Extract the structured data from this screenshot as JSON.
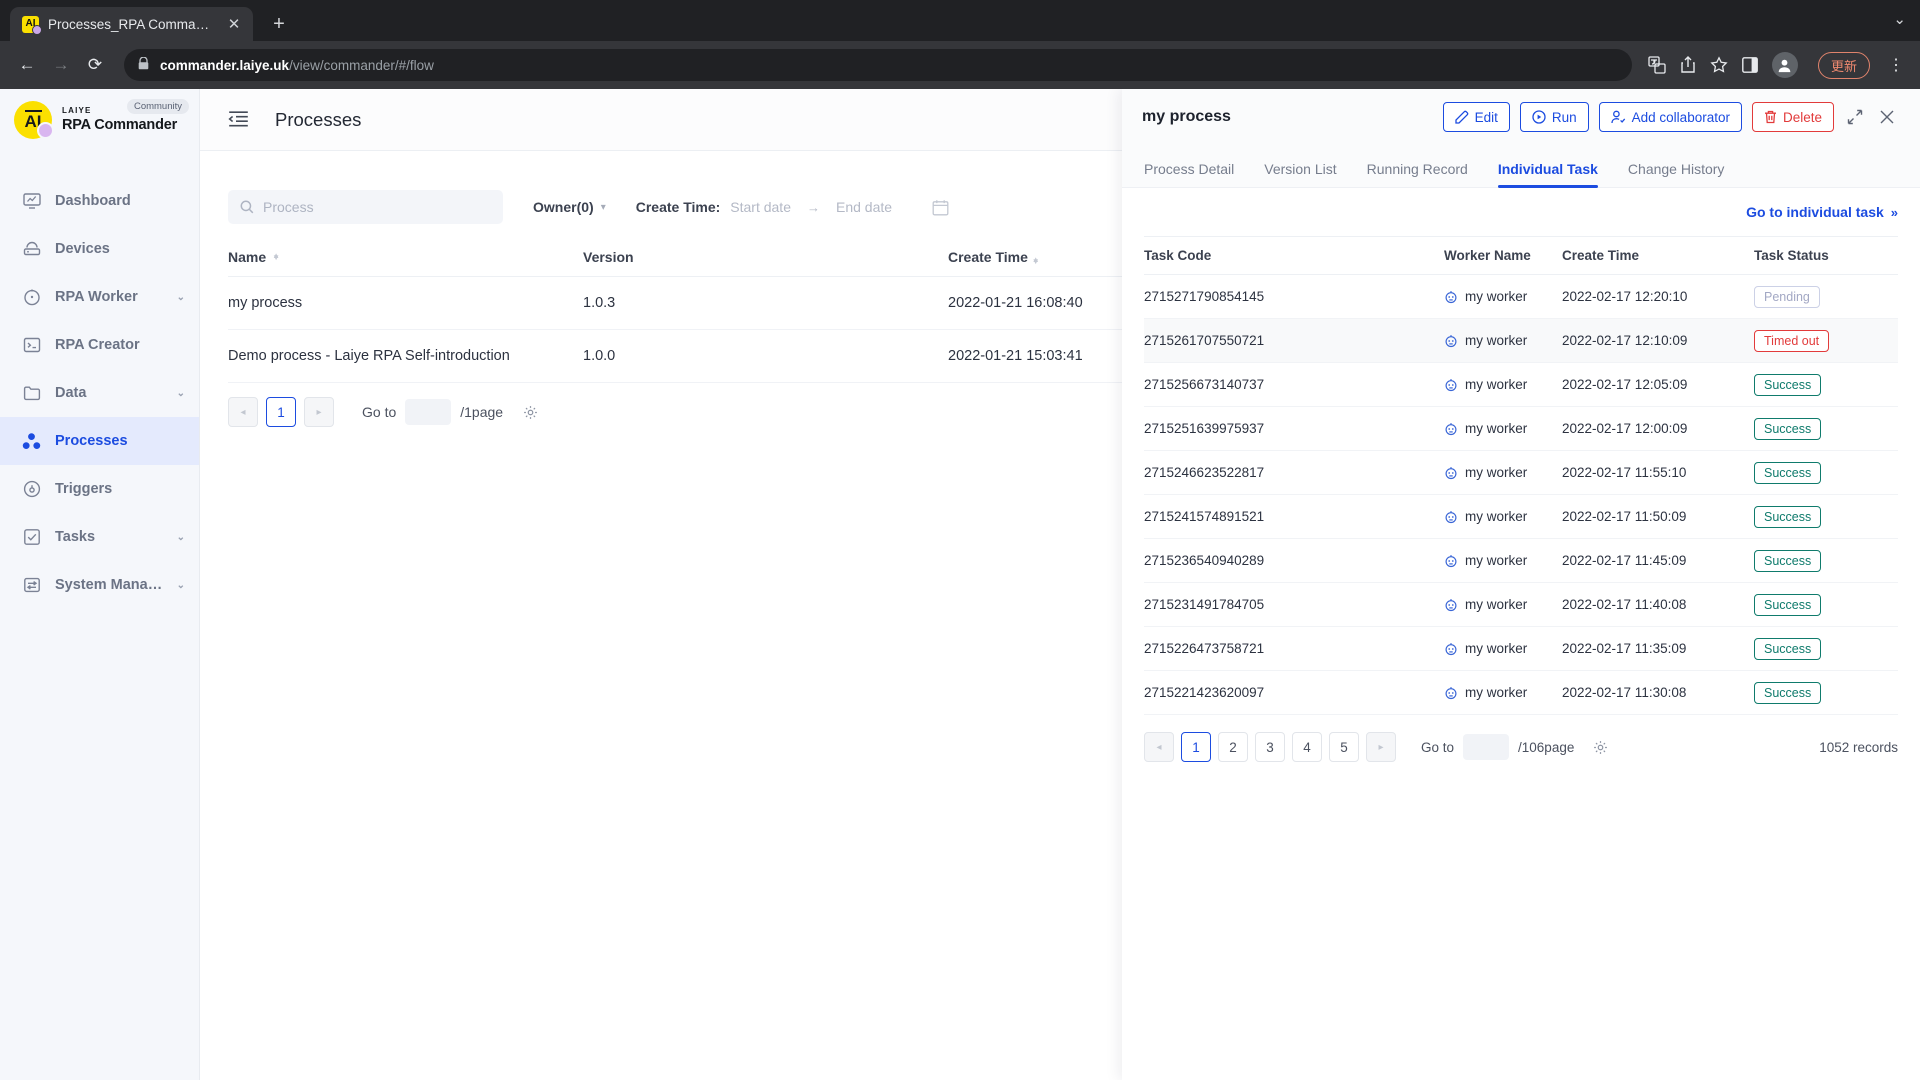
{
  "browser": {
    "tab_title": "Processes_RPA Commander",
    "favicon_text": "AI",
    "close_icon": "close-icon",
    "new_tab_label": "+",
    "window_chevron": "⌄",
    "back_label": "←",
    "forward_label": "→",
    "reload_label": "⟳",
    "lock_icon": "lock-icon",
    "url_host": "commander.laiye.uk",
    "url_path": "/view/commander/#/flow",
    "update_button": "更新",
    "kebab": "⋮"
  },
  "sidebar": {
    "brand_sub": "LAIYE",
    "brand_name": "RPA Commander",
    "brand_badge": "Community",
    "items": [
      {
        "label": "Dashboard",
        "icon": "dashboard-icon",
        "expandable": false,
        "active": false
      },
      {
        "label": "Devices",
        "icon": "devices-icon",
        "expandable": false,
        "active": false
      },
      {
        "label": "RPA Worker",
        "icon": "rpa-worker-icon",
        "expandable": true,
        "active": false
      },
      {
        "label": "RPA Creator",
        "icon": "rpa-creator-icon",
        "expandable": false,
        "active": false
      },
      {
        "label": "Data",
        "icon": "folder-icon",
        "expandable": true,
        "active": false
      },
      {
        "label": "Processes",
        "icon": "processes-icon",
        "expandable": false,
        "active": true
      },
      {
        "label": "Triggers",
        "icon": "triggers-icon",
        "expandable": false,
        "active": false
      },
      {
        "label": "Tasks",
        "icon": "tasks-icon",
        "expandable": true,
        "active": false
      },
      {
        "label": "System Manag...",
        "icon": "system-management-icon",
        "expandable": true,
        "active": false
      }
    ],
    "chevron": "⌄"
  },
  "main": {
    "title": "Processes",
    "collapse_icon": "collapse-sidebar-icon",
    "filters": {
      "search_placeholder": "Process",
      "search_value": "",
      "owner_label": "Owner(0)",
      "create_time_label": "Create Time:",
      "start_date_placeholder": "Start date",
      "end_date_placeholder": "End date",
      "range_arrow": "→",
      "calendar_icon": "calendar-icon"
    },
    "table": {
      "columns": [
        "Name",
        "Version",
        "Create Time"
      ],
      "rows": [
        {
          "name": "my process",
          "version": "1.0.3",
          "create_time": "2022-01-21 16:08:40"
        },
        {
          "name": "Demo process - Laiye RPA Self-introduction",
          "version": "1.0.0",
          "create_time": "2022-01-21 15:03:41"
        }
      ]
    },
    "pager": {
      "prev": "◂",
      "next": "▸",
      "pages": [
        "1"
      ],
      "current": "1",
      "goto_label": "Go to",
      "goto_value": "",
      "total_pages_label": "/1page",
      "gear_icon": "settings-gear-icon"
    }
  },
  "drawer": {
    "title": "my process",
    "buttons": {
      "edit": "Edit",
      "run": "Run",
      "add_collaborator": "Add collaborator",
      "delete": "Delete",
      "expand_icon": "expand-icon",
      "close_icon": "close-icon"
    },
    "tabs": [
      {
        "label": "Process Detail",
        "active": false
      },
      {
        "label": "Version List",
        "active": false
      },
      {
        "label": "Running Record",
        "active": false
      },
      {
        "label": "Individual Task",
        "active": true
      },
      {
        "label": "Change History",
        "active": false
      }
    ],
    "goto_individual_task": "Go to individual task",
    "goto_chevron": "»",
    "table": {
      "columns": [
        "Task Code",
        "Worker Name",
        "Create Time",
        "Task Status"
      ],
      "rows": [
        {
          "task_code": "2715271790854145",
          "worker": "my worker",
          "create_time": "2022-02-17 12:20:10",
          "status": "Pending",
          "status_type": "pending",
          "alt": false
        },
        {
          "task_code": "2715261707550721",
          "worker": "my worker",
          "create_time": "2022-02-17 12:10:09",
          "status": "Timed out",
          "status_type": "timeout",
          "alt": true
        },
        {
          "task_code": "2715256673140737",
          "worker": "my worker",
          "create_time": "2022-02-17 12:05:09",
          "status": "Success",
          "status_type": "success",
          "alt": false
        },
        {
          "task_code": "2715251639975937",
          "worker": "my worker",
          "create_time": "2022-02-17 12:00:09",
          "status": "Success",
          "status_type": "success",
          "alt": false
        },
        {
          "task_code": "2715246623522817",
          "worker": "my worker",
          "create_time": "2022-02-17 11:55:10",
          "status": "Success",
          "status_type": "success",
          "alt": false
        },
        {
          "task_code": "2715241574891521",
          "worker": "my worker",
          "create_time": "2022-02-17 11:50:09",
          "status": "Success",
          "status_type": "success",
          "alt": false
        },
        {
          "task_code": "2715236540940289",
          "worker": "my worker",
          "create_time": "2022-02-17 11:45:09",
          "status": "Success",
          "status_type": "success",
          "alt": false
        },
        {
          "task_code": "2715231491784705",
          "worker": "my worker",
          "create_time": "2022-02-17 11:40:08",
          "status": "Success",
          "status_type": "success",
          "alt": false
        },
        {
          "task_code": "2715226473758721",
          "worker": "my worker",
          "create_time": "2022-02-17 11:35:09",
          "status": "Success",
          "status_type": "success",
          "alt": false
        },
        {
          "task_code": "2715221423620097",
          "worker": "my worker",
          "create_time": "2022-02-17 11:30:08",
          "status": "Success",
          "status_type": "success",
          "alt": false
        }
      ]
    },
    "pager": {
      "prev": "◂",
      "next": "▸",
      "pages": [
        "1",
        "2",
        "3",
        "4",
        "5"
      ],
      "current": "1",
      "goto_label": "Go to",
      "goto_value": "",
      "total_pages_label": "/106page",
      "gear_icon": "settings-gear-icon",
      "records": "1052 records"
    }
  },
  "colors": {
    "accent": "#1c4ce0",
    "danger": "#e23b3b",
    "success": "#0f7b6c",
    "pending": "#a3a8c4",
    "brand_yellow": "#fbe000",
    "update_orange": "#f08a70"
  }
}
